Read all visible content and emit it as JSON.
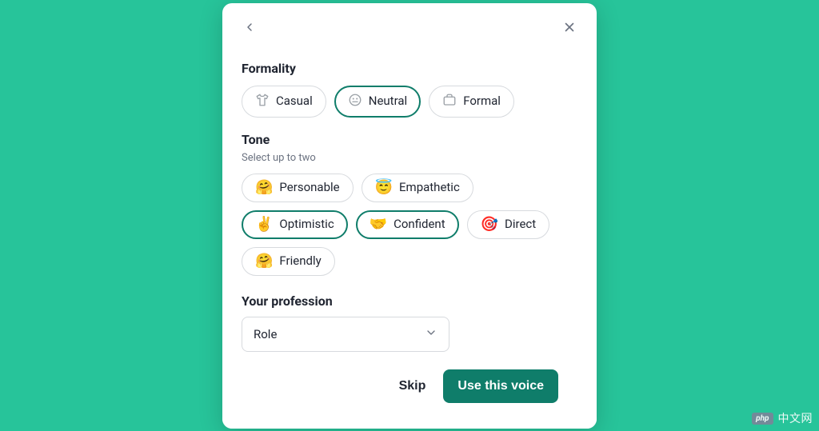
{
  "formality": {
    "title": "Formality",
    "options": [
      {
        "label": "Casual",
        "icon": "tshirt",
        "selected": false
      },
      {
        "label": "Neutral",
        "icon": "face-neutral",
        "selected": true
      },
      {
        "label": "Formal",
        "icon": "briefcase",
        "selected": false
      }
    ]
  },
  "tone": {
    "title": "Tone",
    "hint": "Select up to two",
    "options": [
      {
        "label": "Personable",
        "emoji": "🤗",
        "selected": false
      },
      {
        "label": "Empathetic",
        "emoji": "😇",
        "selected": false
      },
      {
        "label": "Optimistic",
        "emoji": "✌️",
        "selected": true
      },
      {
        "label": "Confident",
        "emoji": "🤝",
        "selected": true
      },
      {
        "label": "Direct",
        "emoji": "🎯",
        "selected": false
      },
      {
        "label": "Friendly",
        "emoji": "🤗",
        "selected": false
      }
    ]
  },
  "profession": {
    "label": "Your profession",
    "placeholder": "Role"
  },
  "footer": {
    "skip": "Skip",
    "submit": "Use this voice"
  },
  "watermark": {
    "badge": "php",
    "text": "中文网"
  }
}
